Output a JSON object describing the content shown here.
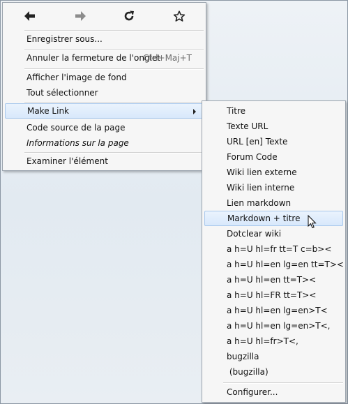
{
  "nav": {
    "back": "back-arrow",
    "forward": "forward-arrow",
    "reload": "reload",
    "bookmark": "star"
  },
  "context_menu": {
    "save_as": "Enregistrer sous...",
    "undo_close_tab": "Annuler la fermeture de l'onglet",
    "undo_close_tab_shortcut": "Ctrl+Maj+T",
    "view_background": "Afficher l'image de fond",
    "select_all": "Tout sélectionner",
    "make_link": "Make Link",
    "view_source": "Code source de la page",
    "page_info": "Informations sur la page",
    "inspect": "Examiner l'élément"
  },
  "submenu": {
    "items": [
      "Titre",
      "Texte URL",
      "URL [en] Texte",
      "Forum Code",
      "Wiki lien externe",
      "Wiki lien interne",
      "Lien markdown",
      "Markdown + titre",
      "Dotclear wiki",
      "a h=U hl=fr tt=T c=b><",
      "a h=U hl=en lg=en tt=T><",
      "a h=U hl=en tt=T><",
      "a h=U hl=FR tt=T><",
      "a h=U hl=en lg=en>T<",
      "a h=U hl=en lg=en>T<,",
      "a h=U hl=fr>T<,",
      "bugzilla",
      " (bugzilla)"
    ],
    "configure": "Configurer..."
  }
}
